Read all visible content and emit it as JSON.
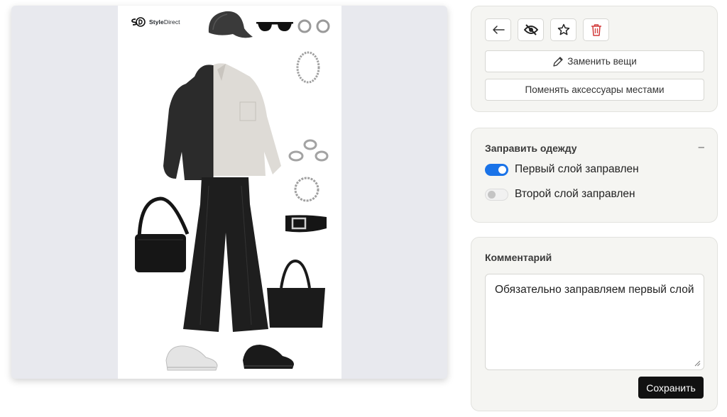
{
  "preview": {
    "logo": {
      "mark": "SD",
      "brand_bold": "Style",
      "brand_light": "Direct"
    }
  },
  "toolbar": {
    "back_icon": "arrow-left-icon",
    "hide_icon": "eye-off-icon",
    "favorite_icon": "star-icon",
    "delete_icon": "trash-icon",
    "replace_label": "Заменить вещи",
    "swap_label": "Поменять аксессуары местами"
  },
  "tuck": {
    "title": "Заправить одежду",
    "collapse": "–",
    "toggles": [
      {
        "label": "Первый слой заправлен",
        "on": true
      },
      {
        "label": "Второй слой заправлен",
        "on": false
      }
    ]
  },
  "comment": {
    "title": "Комментарий",
    "value": "Обязательно заправляем первый слой",
    "save_label": "Сохранить"
  },
  "colors": {
    "accent": "#1a73e8",
    "danger": "#d23a3a",
    "save": "#111111"
  }
}
